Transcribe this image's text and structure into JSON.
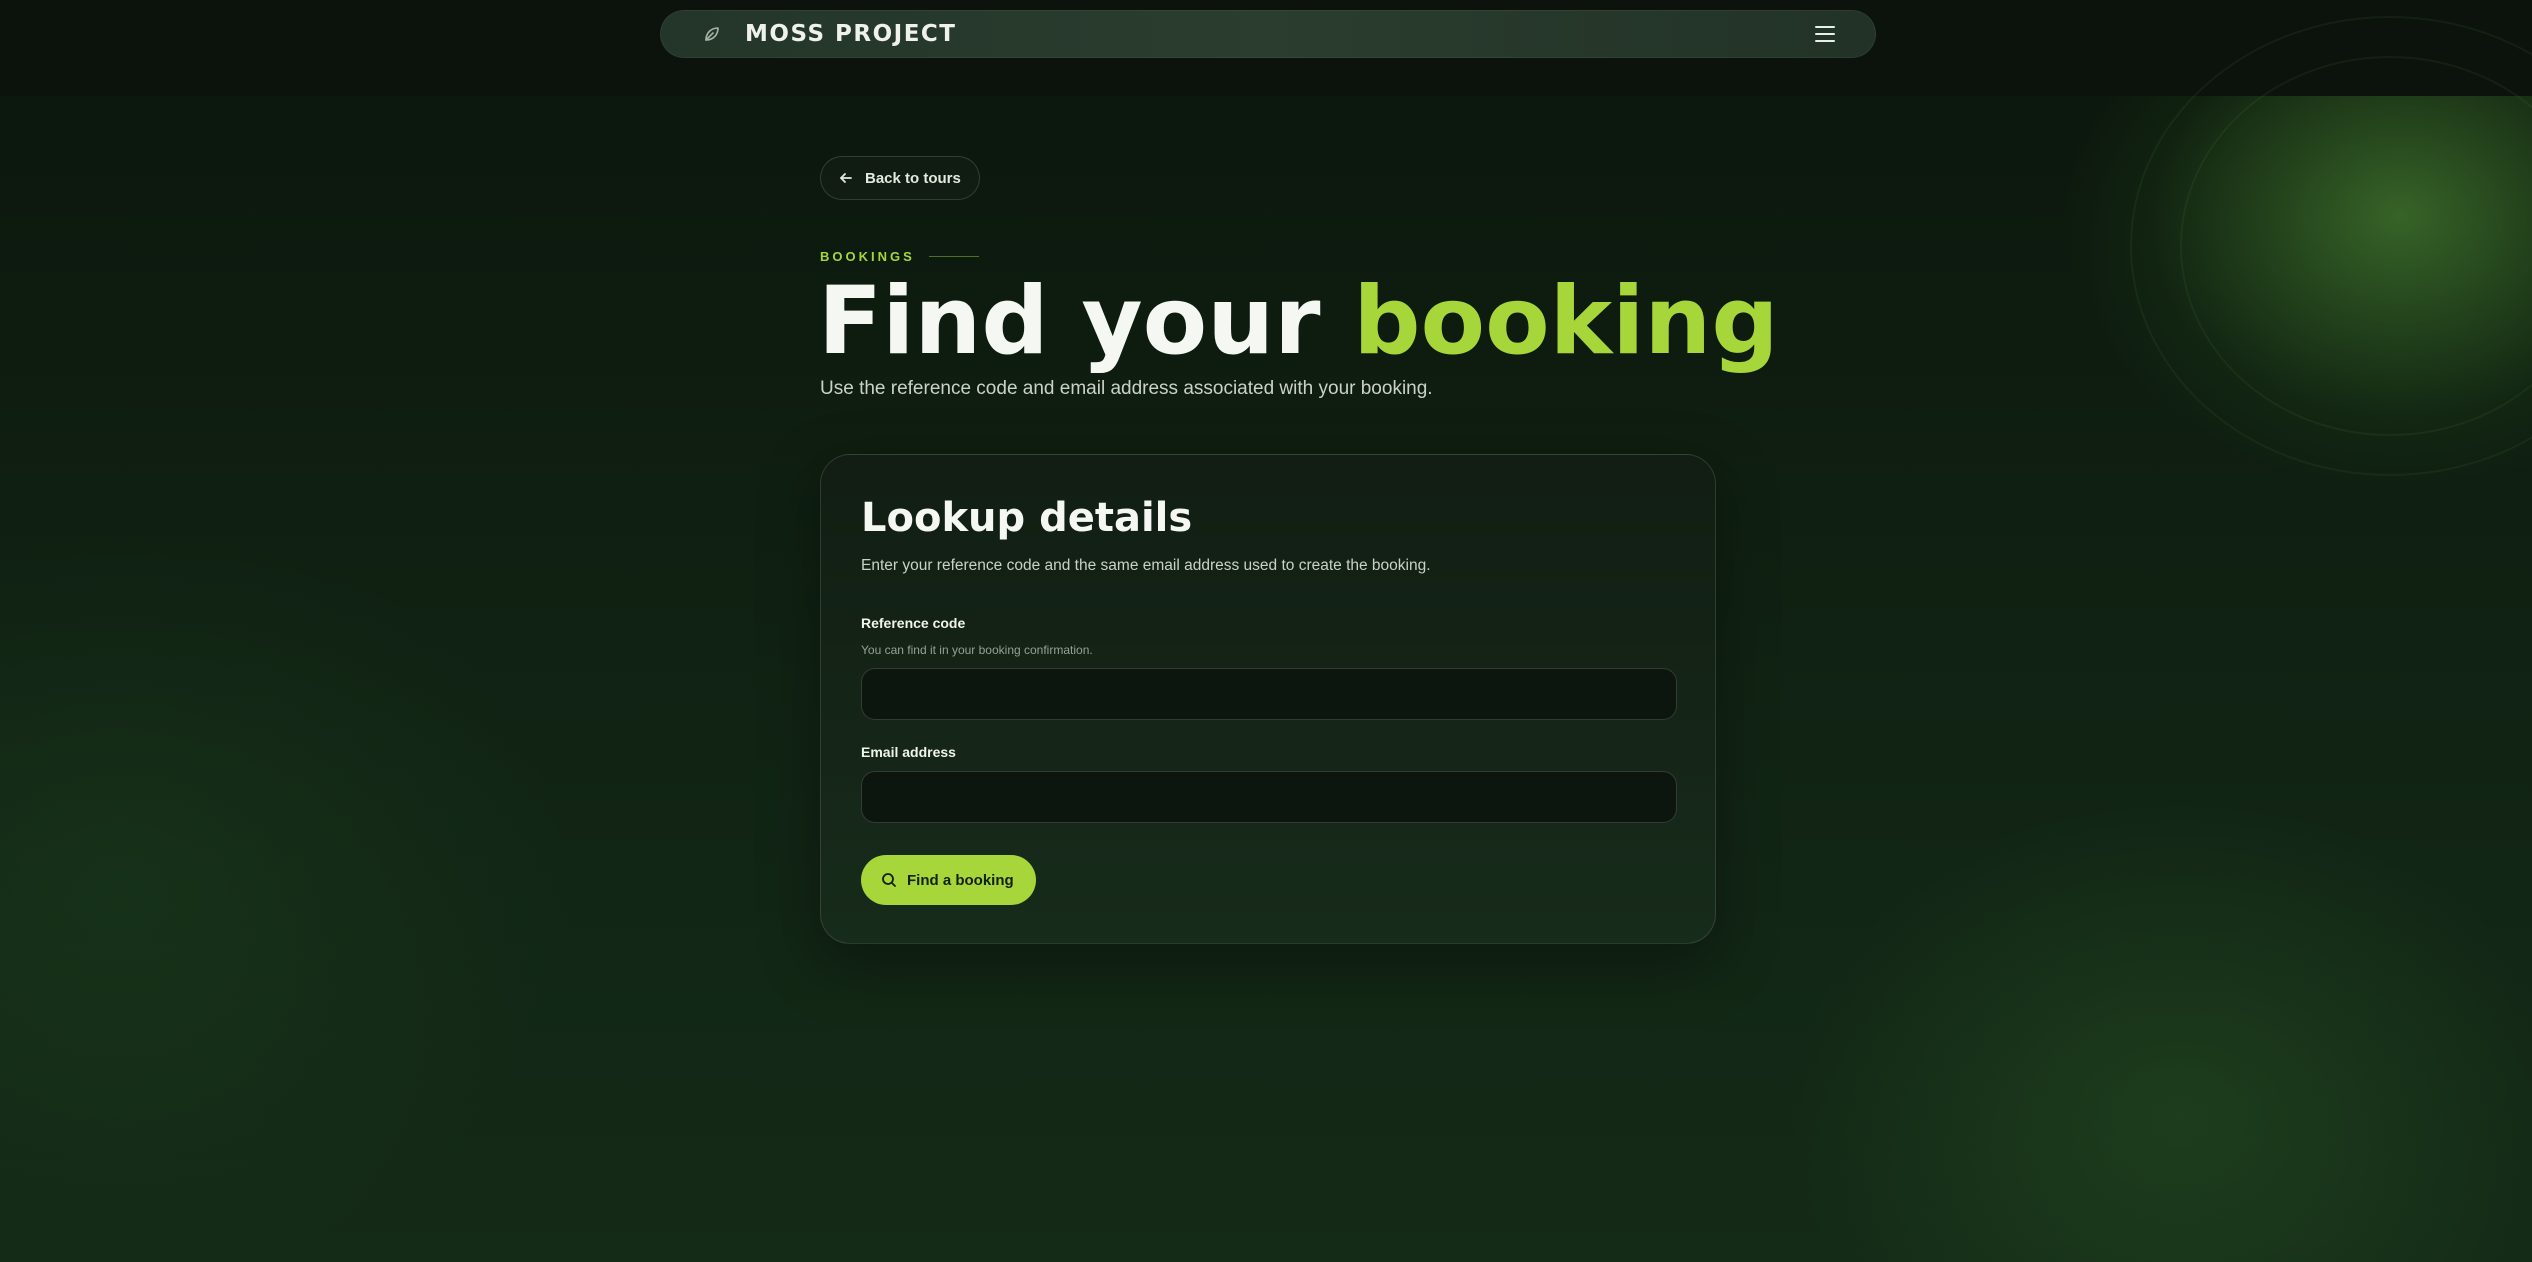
{
  "nav": {
    "brand_name": "MOSS PROJECT",
    "brand_icon": "leaf-icon",
    "menu_icon": "hamburger-menu-icon"
  },
  "back_link": {
    "label": "Back to tours",
    "icon": "arrow-left-icon"
  },
  "hero": {
    "eyebrow": "BOOKINGS",
    "title_main": "Find your ",
    "title_accent": "booking",
    "subtitle": "Use the reference code and email address associated with your booking."
  },
  "form": {
    "title": "Lookup details",
    "description": "Enter your reference code and the same email address used to create the booking.",
    "reference": {
      "label": "Reference code",
      "help": "You can find it in your booking confirmation.",
      "value": "",
      "placeholder": ""
    },
    "email": {
      "label": "Email address",
      "value": "",
      "placeholder": ""
    },
    "submit": {
      "label": "Find a booking",
      "icon": "search-icon"
    }
  },
  "colors": {
    "accent": "#a6d63a",
    "background": "#0f1a10",
    "nav_background": "#26382b",
    "text": "#f5f7f2"
  }
}
